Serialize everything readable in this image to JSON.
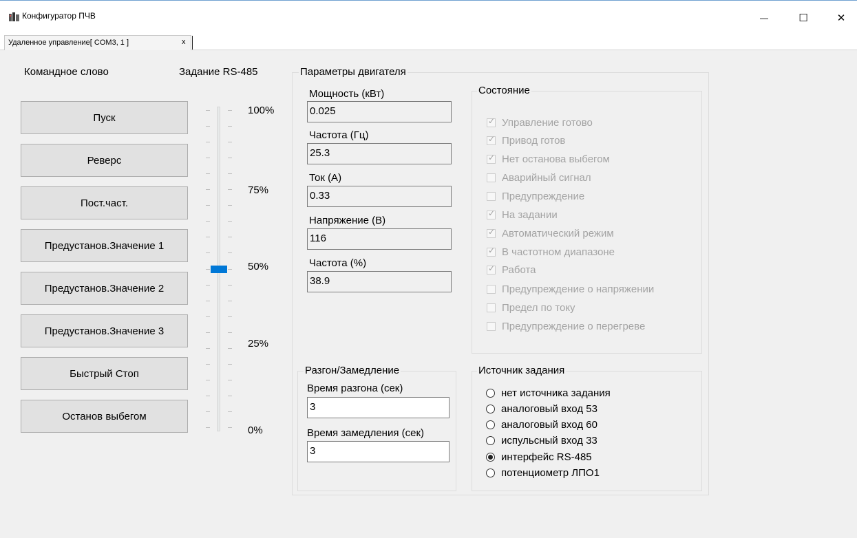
{
  "window": {
    "title": "Конфигуратор ПЧВ",
    "minimize_glyph": "—",
    "maximize_glyph": "☐",
    "close_glyph": "✕"
  },
  "tab": {
    "label": "Удаленное управление[ COM3, 1 ]",
    "close": "x"
  },
  "command": {
    "heading": "Командное слово",
    "buttons": [
      "Пуск",
      "Реверс",
      "Пост.част.",
      "Предустанов.Значение 1",
      "Предустанов.Значение 2",
      "Предустанов.Значение 3",
      "Быстрый Стоп",
      "Останов выбегом"
    ]
  },
  "setpoint": {
    "heading": "Задание RS-485",
    "scale": [
      "100%",
      "75%",
      "50%",
      "25%",
      "0%"
    ],
    "value_percent": 50
  },
  "motor": {
    "title": "Параметры двигателя",
    "fields": [
      {
        "label": "Мощность (кВт)",
        "value": "0.025"
      },
      {
        "label": "Частота (Гц)",
        "value": "25.3"
      },
      {
        "label": "Ток (А)",
        "value": "0.33"
      },
      {
        "label": "Напряжение (В)",
        "value": "116"
      },
      {
        "label": "Частота (%)",
        "value": "38.9"
      }
    ]
  },
  "status": {
    "title": "Состояние",
    "items": [
      {
        "label": "Управление готово",
        "checked": true
      },
      {
        "label": "Привод готов",
        "checked": true
      },
      {
        "label": "Нет останова выбегом",
        "checked": true
      },
      {
        "label": "Аварийный сигнал",
        "checked": false
      },
      {
        "label": "Предупреждение",
        "checked": false
      },
      {
        "label": "На задании",
        "checked": true
      },
      {
        "label": "Автоматический режим",
        "checked": true
      },
      {
        "label": "В частотном диапазоне",
        "checked": true
      },
      {
        "label": "Работа",
        "checked": true
      },
      {
        "label": "Предупреждение о напряжении",
        "checked": false
      },
      {
        "label": "Предел по току",
        "checked": false
      },
      {
        "label": "Предупреждение о перегреве",
        "checked": false
      }
    ]
  },
  "ramp": {
    "title": "Разгон/Замедление",
    "accel_label": "Время разгона (сек)",
    "accel_value": "3",
    "decel_label": "Время замедления (сек)",
    "decel_value": "3"
  },
  "source": {
    "title": "Источник задания",
    "options": [
      "нет источника задания",
      "аналоговый вход 53",
      "аналоговый вход 60",
      "испульсный вход 33",
      "интерфейс RS-485",
      "потенциометр ЛПО1"
    ],
    "selected": 4
  }
}
